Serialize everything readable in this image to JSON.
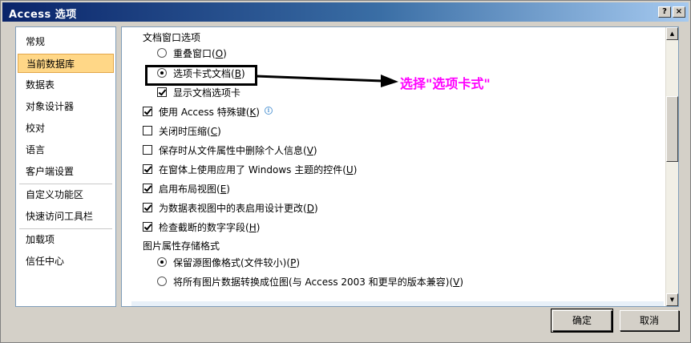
{
  "window": {
    "title": "Access 选项",
    "help_label": "?",
    "close_label": "×"
  },
  "sidebar": {
    "items": [
      {
        "label": "常规"
      },
      {
        "label": "当前数据库"
      },
      {
        "label": "数据表"
      },
      {
        "label": "对象设计器"
      },
      {
        "label": "校对"
      },
      {
        "label": "语言"
      },
      {
        "label": "客户端设置"
      },
      {
        "label": "自定义功能区"
      },
      {
        "label": "快速访问工具栏"
      },
      {
        "label": "加载项"
      },
      {
        "label": "信任中心"
      }
    ],
    "active_item": "当前数据库"
  },
  "content": {
    "doc_window_section": "文档窗口选项",
    "overlap_windows": {
      "label": "重叠窗口",
      "key": "O",
      "checked": false
    },
    "tabbed_documents": {
      "label": "选项卡式文档",
      "key": "B",
      "checked": true
    },
    "display_doc_tabs": {
      "label": "显示文档选项卡",
      "checked": true
    },
    "access_special_keys": {
      "label": "使用 Access 特殊键",
      "key": "K",
      "checked": true
    },
    "compact_on_close": {
      "label": "关闭时压缩",
      "key": "C",
      "checked": false
    },
    "remove_personal_info": {
      "label": "保存时从文件属性中删除个人信息",
      "key": "V",
      "checked": false
    },
    "use_windows_themes": {
      "label": "在窗体上使用应用了 Windows 主题的控件",
      "key": "U",
      "checked": true
    },
    "enable_layout_view": {
      "label": "启用布局视图",
      "key": "E",
      "checked": true
    },
    "enable_design_changes": {
      "label": "为数据表视图中的表启用设计更改",
      "key": "D",
      "checked": true
    },
    "check_truncated": {
      "label": "检查截断的数字字段",
      "key": "H",
      "checked": true
    },
    "picture_storage_section": "图片属性存储格式",
    "preserve_source_format": {
      "label": "保留源图像格式(文件较小)",
      "key": "P",
      "checked": true
    },
    "convert_to_bitmap": {
      "label": "将所有图片数据转换成位图(与 Access 2003 和更早的版本兼容)",
      "key": "V",
      "checked": false
    }
  },
  "annotation": {
    "text": "选择\"选项卡式\""
  },
  "buttons": {
    "ok_label": "确定",
    "cancel_label": "取消"
  },
  "colors": {
    "annotation": "#ff00ff",
    "active_nav_bg": "#ffd787",
    "title_bar": "#0a246a"
  }
}
